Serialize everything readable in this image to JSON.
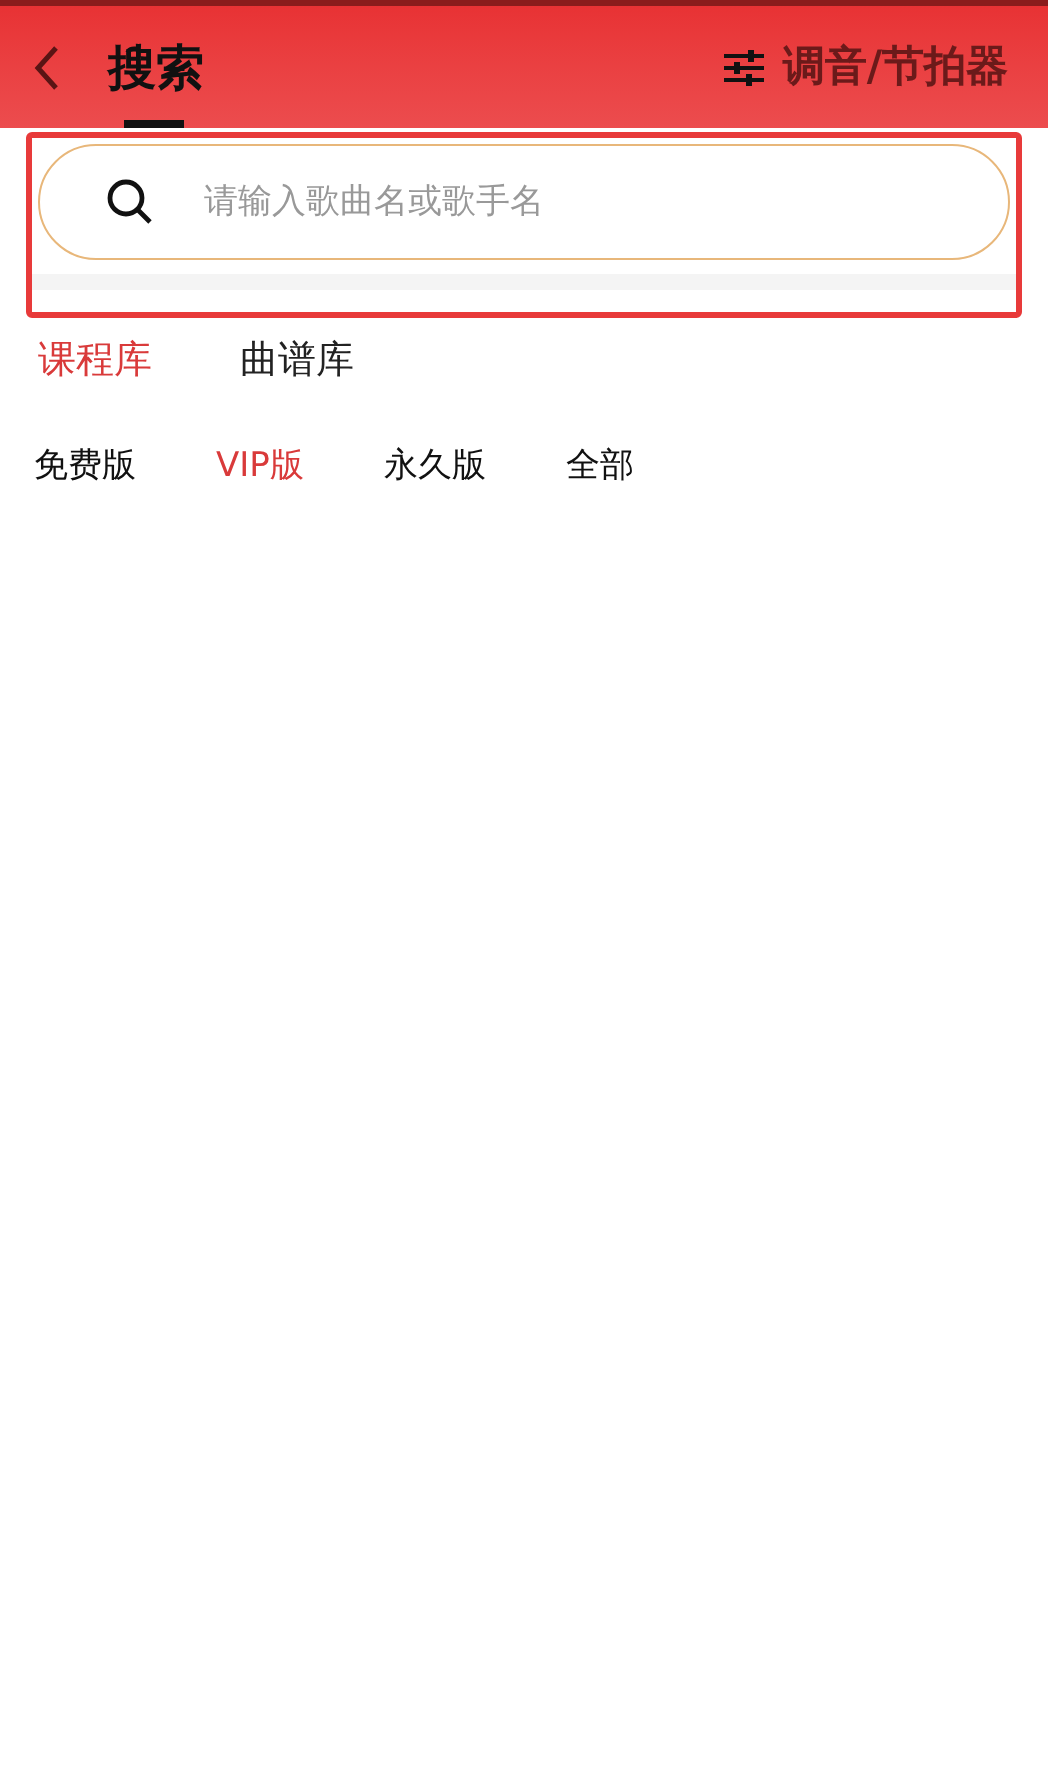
{
  "header": {
    "title": "搜索",
    "action": "调音/节拍器"
  },
  "search": {
    "placeholder": "请输入歌曲名或歌手名"
  },
  "tabs": [
    {
      "label": "课程库",
      "selected": true
    },
    {
      "label": "曲谱库",
      "selected": false
    }
  ],
  "filters": [
    {
      "label": "免费版",
      "selected": false
    },
    {
      "label": "VIP版",
      "selected": true
    },
    {
      "label": "永久版",
      "selected": false
    },
    {
      "label": "全部",
      "selected": false
    }
  ]
}
